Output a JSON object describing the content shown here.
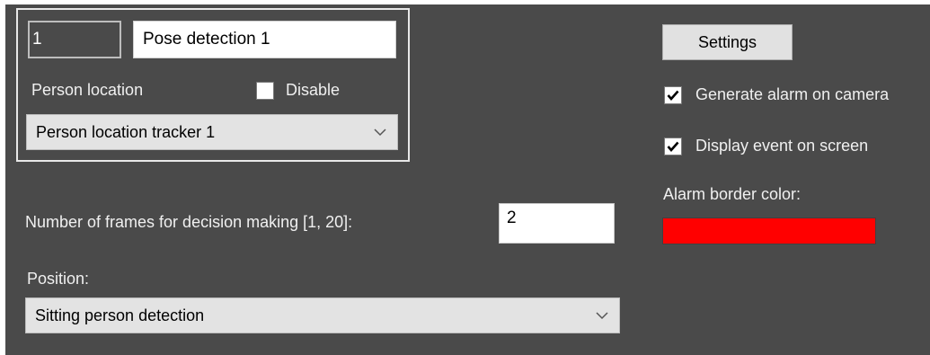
{
  "detector": {
    "id_value": "1",
    "name_value": "Pose detection 1",
    "person_location_label": "Person location",
    "disable_label": "Disable",
    "disable_checked": false,
    "tracker_selected": "Person location tracker 1"
  },
  "frames": {
    "label": "Number of frames for decision making [1, 20]:",
    "value": "2"
  },
  "position": {
    "label": "Position:",
    "selected": "Sitting person detection"
  },
  "settings_button_label": "Settings",
  "options": {
    "generate_alarm_label": "Generate alarm on camera",
    "generate_alarm_checked": true,
    "display_event_label": "Display event on screen",
    "display_event_checked": true
  },
  "alarm_border": {
    "label": "Alarm border color:",
    "color": "#ff0000"
  },
  "icons": {
    "dropdown_arrow": "chevron-down-icon",
    "checkmark": "checkmark-icon"
  },
  "colors": {
    "panel_background": "#4a4a4a",
    "text": "#f0f0f0"
  }
}
